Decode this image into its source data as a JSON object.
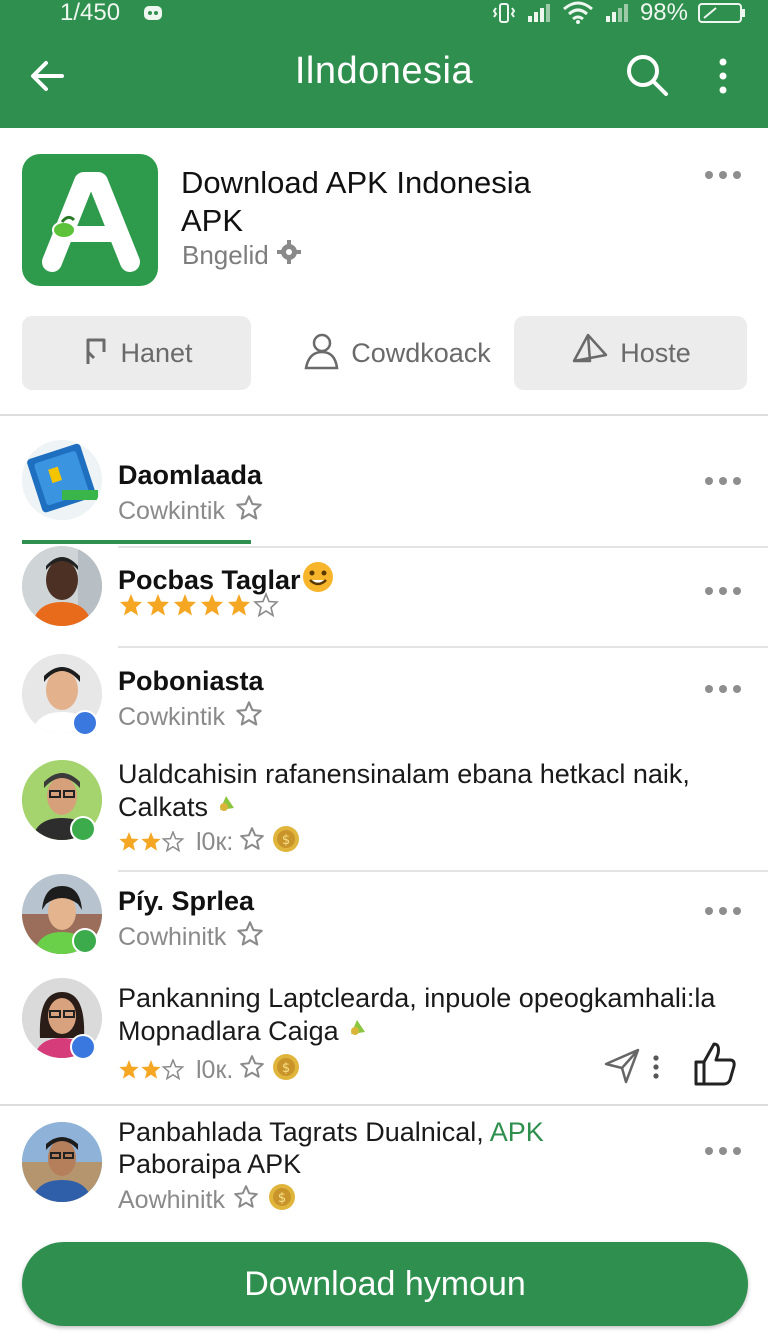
{
  "status_bar": {
    "time": "1/450",
    "battery": "98%"
  },
  "header": {
    "title": "Ilndonesia"
  },
  "app": {
    "title_line1": "Download APK Indonesia",
    "title_line2": "APK",
    "developer": "Bngelid"
  },
  "tabs": [
    {
      "label": "Hanet",
      "icon": "bookmark-icon",
      "selected": true
    },
    {
      "label": "Cowdkoack",
      "icon": "person-icon",
      "selected": false
    },
    {
      "label": "Hoste",
      "icon": "send-icon",
      "selected": false
    }
  ],
  "items": [
    {
      "name": "Daomlaada",
      "sub": "Cowkintik",
      "kind": "simple"
    },
    {
      "name": "Pocbas Taglar",
      "rating": 4,
      "kind": "rated"
    },
    {
      "name": "Poboniasta",
      "sub": "Cowkintik",
      "kind": "simple"
    },
    {
      "text_line1": "Ualdcahisin rafanensinalam ebana hetkacl naik,",
      "text_line2": "Calkats",
      "count": "l0к:",
      "rating": 2,
      "kind": "review"
    },
    {
      "name": "Píy. Sprlea",
      "sub": "Cowhinitk",
      "kind": "simple"
    },
    {
      "text_line1": "Pankanning Laptcleardа, inpuole opeogkamhali:la",
      "text_line2": "Mopnadlara Caiga",
      "count": "l0к.",
      "rating": 2,
      "kind": "review"
    },
    {
      "text_line1_a": "Panbahlada Tagrats Dualnical,",
      "text_line1_b": "APK",
      "text_line2": "Paboraipa APK",
      "sub": "Aowhinitk",
      "kind": "review2"
    }
  ],
  "download_button": "Download hymoun",
  "colors": {
    "brand": "#2f8f4e",
    "star": "#f5a623"
  }
}
